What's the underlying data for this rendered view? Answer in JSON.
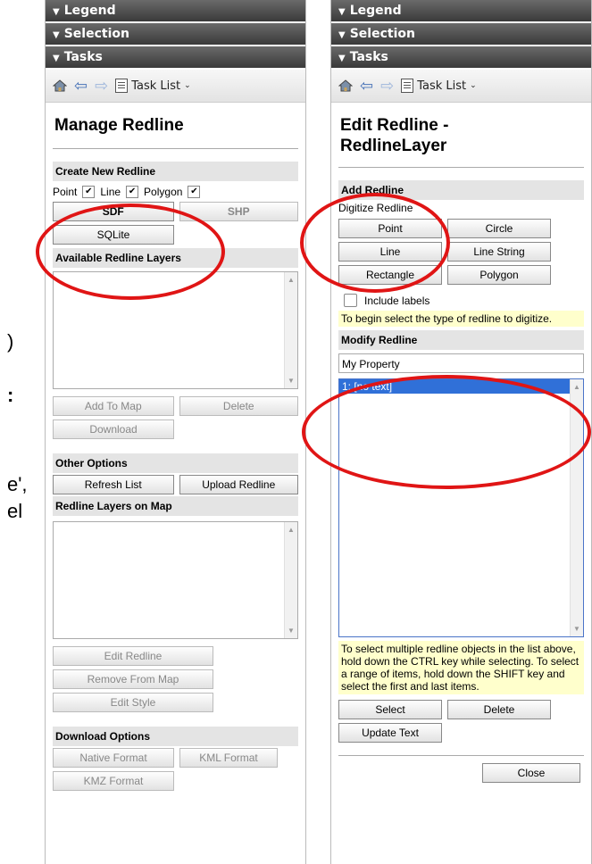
{
  "fragments": [
    ")",
    ":",
    "e',",
    "el"
  ],
  "icons": [
    "home-icon",
    "back-arrow-icon",
    "forward-arrow-icon",
    "task-list-icon"
  ],
  "left": {
    "bars": [
      "Legend",
      "Selection",
      "Tasks"
    ],
    "toolbar": {
      "task_list": "Task List"
    },
    "title": "Manage Redline",
    "create": {
      "header": "Create New Redline",
      "point": "Point",
      "line": "Line",
      "polygon": "Polygon",
      "sdf": "SDF",
      "shp": "SHP",
      "sqlite": "SQLite"
    },
    "available": {
      "header": "Available Redline Layers",
      "add_to_map": "Add To Map",
      "delete": "Delete",
      "download": "Download"
    },
    "other": {
      "header": "Other Options",
      "refresh": "Refresh List",
      "upload": "Upload Redline"
    },
    "onmap": {
      "header": "Redline Layers on Map",
      "edit": "Edit Redline",
      "remove": "Remove From Map",
      "style": "Edit Style"
    },
    "download": {
      "header": "Download Options",
      "native": "Native Format",
      "kml": "KML Format",
      "kmz": "KMZ Format"
    }
  },
  "right": {
    "bars": [
      "Legend",
      "Selection",
      "Tasks"
    ],
    "toolbar": {
      "task_list": "Task List"
    },
    "title_line1": "Edit Redline -",
    "title_line2": "RedlineLayer",
    "add": {
      "header": "Add Redline",
      "sub": "Digitize Redline",
      "point": "Point",
      "circle": "Circle",
      "line": "Line",
      "linestring": "Line String",
      "rectangle": "Rectangle",
      "polygon": "Polygon",
      "include_labels": "Include labels",
      "hint": "To begin select the type of redline to digitize."
    },
    "modify": {
      "header": "Modify Redline",
      "text_value": "My Property",
      "items": [
        "1: [no text]"
      ],
      "hint": "To select multiple redline objects in the list above, hold down the CTRL key while selecting. To select a range of items, hold down the SHIFT key and select the first and last items.",
      "select": "Select",
      "delete": "Delete",
      "update": "Update Text"
    },
    "close": "Close"
  },
  "colors": {
    "highlight_circle": "#e01515",
    "selection": "#3070d8",
    "hint_bg": "#ffffcc"
  }
}
